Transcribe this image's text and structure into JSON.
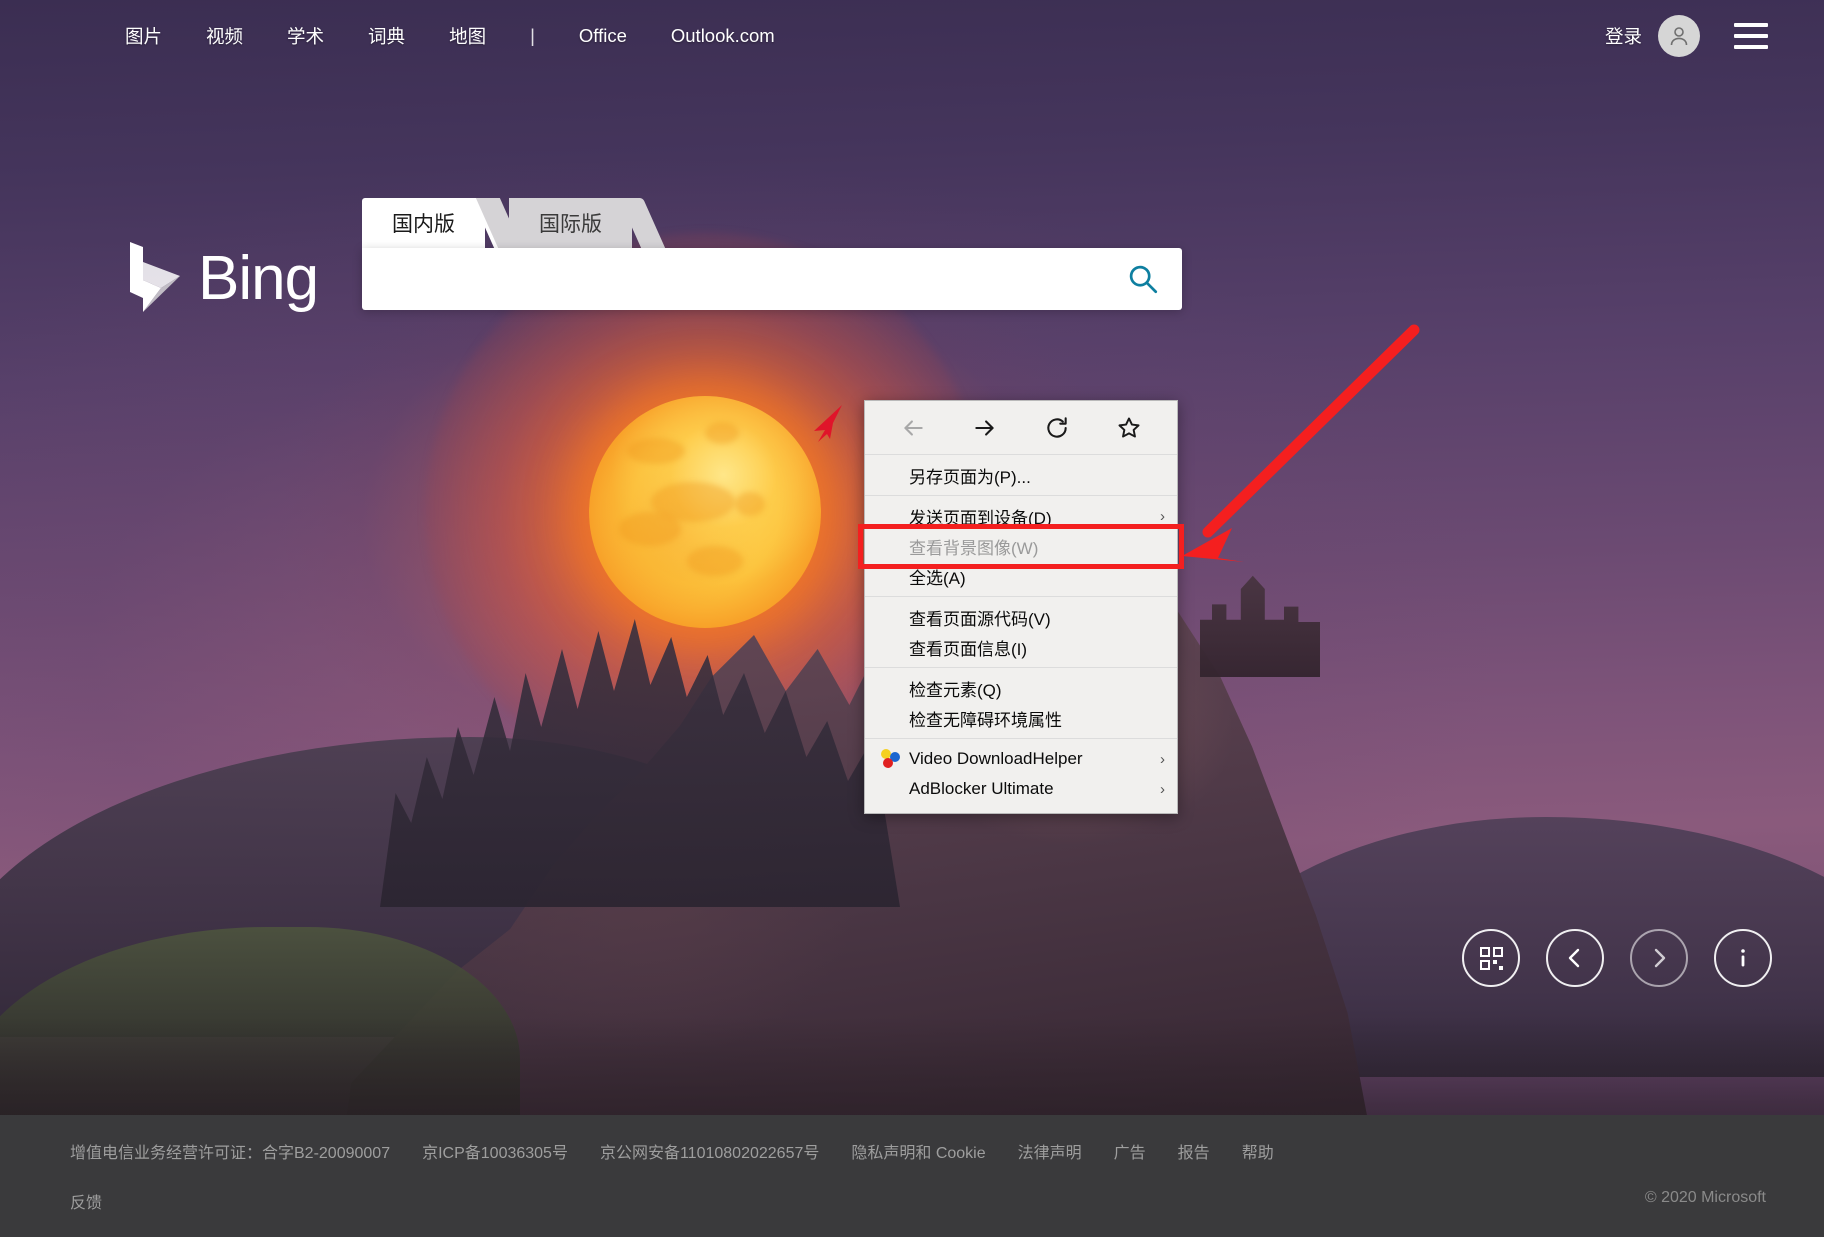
{
  "header": {
    "nav": [
      {
        "label": "图片",
        "name": "nav-images"
      },
      {
        "label": "视频",
        "name": "nav-videos"
      },
      {
        "label": "学术",
        "name": "nav-academic"
      },
      {
        "label": "词典",
        "name": "nav-dictionary"
      },
      {
        "label": "地图",
        "name": "nav-maps"
      }
    ],
    "separator": "|",
    "apps": [
      {
        "label": "Office",
        "name": "nav-office"
      },
      {
        "label": "Outlook.com",
        "name": "nav-outlook"
      }
    ],
    "sign_in": "登录",
    "avatar_icon": "user-avatar-icon",
    "menu_icon": "hamburger-menu-icon"
  },
  "logo": {
    "text": "Bing",
    "mark_icon": "bing-b-logo-icon"
  },
  "search": {
    "tabs": [
      {
        "label": "国内版",
        "active": true,
        "name": "tab-domestic"
      },
      {
        "label": "国际版",
        "active": false,
        "name": "tab-international"
      }
    ],
    "value": "",
    "placeholder": "",
    "button_icon": "search-magnifier-icon"
  },
  "context_menu": {
    "nav_buttons": [
      {
        "icon": "back-arrow-icon",
        "label": "后退",
        "disabled": true
      },
      {
        "icon": "forward-arrow-icon",
        "label": "前进",
        "disabled": false
      },
      {
        "icon": "reload-icon",
        "label": "重新载入",
        "disabled": false
      },
      {
        "icon": "star-bookmark-icon",
        "label": "收藏",
        "disabled": false
      }
    ],
    "groups": [
      {
        "items": [
          {
            "label": "另存页面为(P)...",
            "name": "menu-save-page-as",
            "disabled": false,
            "submenu": false,
            "icon": null
          }
        ]
      },
      {
        "items": [
          {
            "label": "发送页面到设备(D)",
            "name": "menu-send-page-to-device",
            "disabled": false,
            "submenu": true,
            "icon": null
          },
          {
            "label": "查看背景图像(W)",
            "name": "menu-view-background-image",
            "disabled": true,
            "submenu": false,
            "icon": null,
            "highlighted": true
          },
          {
            "label": "全选(A)",
            "name": "menu-select-all",
            "disabled": false,
            "submenu": false,
            "icon": null
          }
        ]
      },
      {
        "items": [
          {
            "label": "查看页面源代码(V)",
            "name": "menu-view-page-source",
            "disabled": false,
            "submenu": false,
            "icon": null
          },
          {
            "label": "查看页面信息(I)",
            "name": "menu-view-page-info",
            "disabled": false,
            "submenu": false,
            "icon": null
          }
        ]
      },
      {
        "items": [
          {
            "label": "检查元素(Q)",
            "name": "menu-inspect-element",
            "disabled": false,
            "submenu": false,
            "icon": null
          },
          {
            "label": "检查无障碍环境属性",
            "name": "menu-inspect-accessibility",
            "disabled": false,
            "submenu": false,
            "icon": null
          }
        ]
      },
      {
        "items": [
          {
            "label": "Video DownloadHelper",
            "name": "menu-video-downloadhelper",
            "disabled": false,
            "submenu": true,
            "icon": "video-downloadhelper-icon"
          },
          {
            "label": "AdBlocker Ultimate",
            "name": "menu-adblocker-ultimate",
            "disabled": false,
            "submenu": true,
            "icon": "adblocker-ultimate-shield-icon"
          }
        ]
      }
    ],
    "submenu_arrow": "›"
  },
  "annotations": {
    "highlight_color": "#f41f1f",
    "arrow_color": "#f41f1f",
    "cursor_color": "#e01020",
    "highlight_target": "查看背景图像(W)"
  },
  "image_controls": [
    {
      "icon": "qr-code-icon",
      "name": "btn-qr-code",
      "dim": false
    },
    {
      "icon": "chevron-left-icon",
      "name": "btn-prev-image",
      "dim": false
    },
    {
      "icon": "chevron-right-icon",
      "name": "btn-next-image",
      "dim": true
    },
    {
      "icon": "info-icon",
      "name": "btn-image-info",
      "dim": false
    }
  ],
  "footer": {
    "row1": [
      {
        "label": "增值电信业务经营许可证：合字B2-20090007",
        "link": false,
        "name": "footer-telecom-license"
      },
      {
        "label": "京ICP备10036305号",
        "link": true,
        "name": "footer-icp"
      },
      {
        "label": "京公网安备11010802022657号",
        "link": true,
        "name": "footer-public-security"
      },
      {
        "label": "隐私声明和 Cookie",
        "link": true,
        "name": "footer-privacy-cookies"
      },
      {
        "label": "法律声明",
        "link": true,
        "name": "footer-legal"
      },
      {
        "label": "广告",
        "link": true,
        "name": "footer-advertise"
      },
      {
        "label": "报告",
        "link": true,
        "name": "footer-report"
      },
      {
        "label": "帮助",
        "link": true,
        "name": "footer-help"
      }
    ],
    "row2": [
      {
        "label": "反馈",
        "link": true,
        "name": "footer-feedback"
      }
    ],
    "copyright": "© 2020 Microsoft"
  },
  "theme": {
    "accent_search": "#0e7490",
    "footer_bg": "#3a3a3c",
    "menu_bg": "#f1f0ee",
    "sky_top": "#3b2e52",
    "moon": "#fcc23b"
  }
}
